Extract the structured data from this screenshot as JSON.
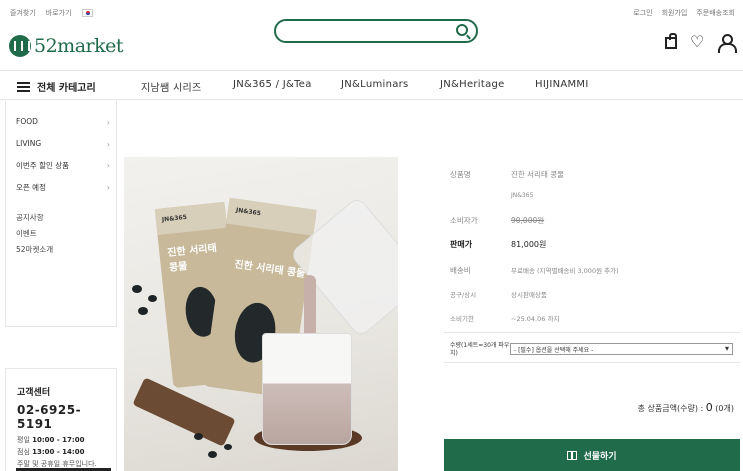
{
  "topbar": {
    "left": [
      "즐겨찾기",
      "바로가기"
    ],
    "right": [
      "로그인",
      "회원가입",
      "주문배송조회"
    ]
  },
  "logo": {
    "text": "52market"
  },
  "search": {
    "placeholder": ""
  },
  "nav": {
    "all_categories": "전체 카테고리",
    "items": [
      "지남쌤 시리즈",
      "JN&365 / J&Tea",
      "JN&Luminars",
      "JN&Heritage",
      "HIJINAMMI"
    ]
  },
  "sidebar": {
    "menu": [
      "FOOD",
      "LIVING",
      "이번주 할인 상품",
      "오픈 예정"
    ],
    "links": [
      "공지사항",
      "이벤트",
      "52마켓소개"
    ]
  },
  "customer_center": {
    "title": "고객센터",
    "phone": "02-6925-5191",
    "weekday_label": "평일",
    "weekday_hours": "10:00 - 17:00",
    "lunch_label": "점심",
    "lunch_hours": "13:00 - 14:00",
    "closed": "주말 및 공휴일 휴무입니다."
  },
  "product_image": {
    "pouch_text": "진한 서리태 콩물",
    "brand": "JN&365"
  },
  "product": {
    "name_label": "상품명",
    "name": "진한 서리태 콩물",
    "brand": "JN&365",
    "consumer_price_label": "소비자가",
    "consumer_price": "90,000원",
    "sale_price_label": "판매가",
    "sale_price": "81,000원",
    "shipping_label": "배송비",
    "shipping": "무료배송 (지역별배송비 3,000원 추가)",
    "group_label": "공구/상시",
    "group": "상시판매상품",
    "expiry_label": "소비기한",
    "expiry": "~25.04.06 까지",
    "option_label": "수량(1세트=30개 파우치)",
    "option_value": "- [필수] 옵션을 선택해 주세요 -",
    "total_label": "총 상품금액(수량) :",
    "total_value": "0",
    "total_count": "(0개)",
    "gift_button": "선물하기"
  }
}
